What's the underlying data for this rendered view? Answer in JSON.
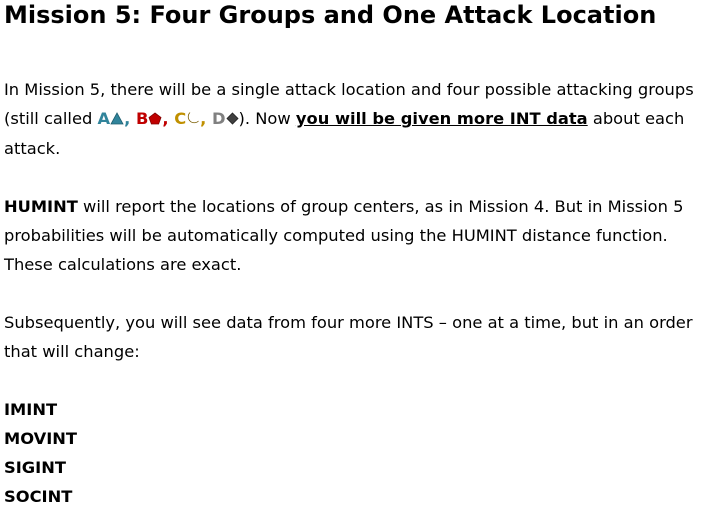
{
  "title": "Mission 5: Four Groups and One Attack Location",
  "colors": {
    "group_a": "#31849B",
    "group_b": "#C00000",
    "group_c": "#C09000",
    "group_d": "#808080",
    "text": "#000000"
  },
  "icons": {
    "group_a": "triangle-icon",
    "group_b": "pentagon-icon",
    "group_c": "crescent-icon",
    "group_d": "diamond-icon"
  },
  "paragraph1": {
    "intro": "In Mission 5, there will be a single attack location and four possible attacking groups (still called ",
    "group_a": "A",
    "sep1": ", ",
    "group_b": "B",
    "sep2": ", ",
    "group_c": "C",
    "sep3": ", ",
    "group_d": "D",
    "after_groups": "). Now ",
    "emphasis": "you will be given more INT data",
    "outro": " about each attack."
  },
  "paragraph2": {
    "lead": "HUMINT",
    "text": " will report the locations of group centers, as in Mission 4. But in Mission 5 probabilities will be automatically computed using the HUMINT distance function. These calculations are exact."
  },
  "paragraph3": {
    "text": "Subsequently, you will see data from four more INTS – one at a time, but in an order that will change:"
  },
  "int_list": [
    "IMINT",
    "MOVINT",
    "SIGINT",
    "SOCINT"
  ]
}
